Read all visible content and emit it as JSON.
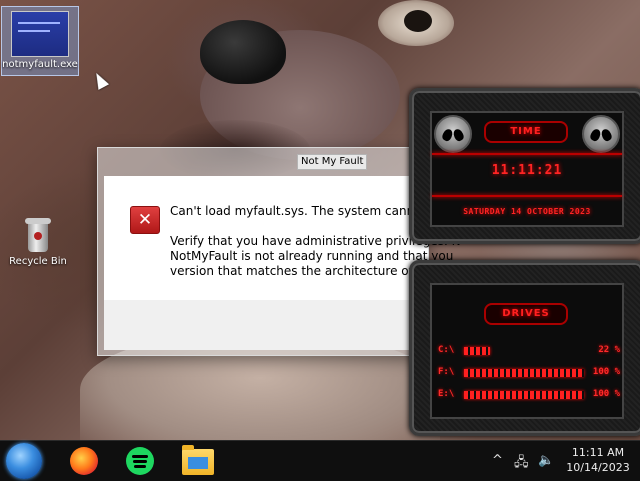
{
  "desktop": {
    "icons": [
      {
        "label": "notmyfault.exe",
        "icon": "executable-window-icon",
        "selected": true
      },
      {
        "label": "Recycle Bin",
        "icon": "recycle-bin-icon"
      }
    ]
  },
  "dialog": {
    "title": "Not My Fault",
    "icon": "error-x-icon",
    "message_line1": "Can't load myfault.sys. The system cannot fin",
    "message_lines": [
      "Verify that you have administrative privileges. N",
      "NotMyFault is not already running and that you",
      "version that matches the architecture of your"
    ]
  },
  "time_gadget": {
    "tab_label": "TIME",
    "time": "11:11:21",
    "date": "SATURDAY 14 OCTOBER 2023"
  },
  "drives_gadget": {
    "tab_label": "DRIVES",
    "drives": [
      {
        "label": "C:\\",
        "percent": 22,
        "percent_text": "22 %"
      },
      {
        "label": "F:\\",
        "percent": 100,
        "percent_text": "100 %"
      },
      {
        "label": "E:\\",
        "percent": 100,
        "percent_text": "100 %"
      }
    ]
  },
  "taskbar": {
    "apps": [
      {
        "name": "start",
        "icon": "start-orb-icon"
      },
      {
        "name": "firefox",
        "icon": "firefox-icon"
      },
      {
        "name": "spotify",
        "icon": "spotify-icon"
      },
      {
        "name": "file-explorer",
        "icon": "folder-icon"
      }
    ],
    "tray": {
      "chevron": "^",
      "network_icon": "network-icon",
      "volume_icon": "speaker-icon"
    },
    "clock_time": "11:11 AM",
    "clock_date": "10/14/2023"
  },
  "colors": {
    "accent_red": "#ff2424",
    "error_red": "#d02c2c",
    "taskbar": "#0f0f0f"
  }
}
